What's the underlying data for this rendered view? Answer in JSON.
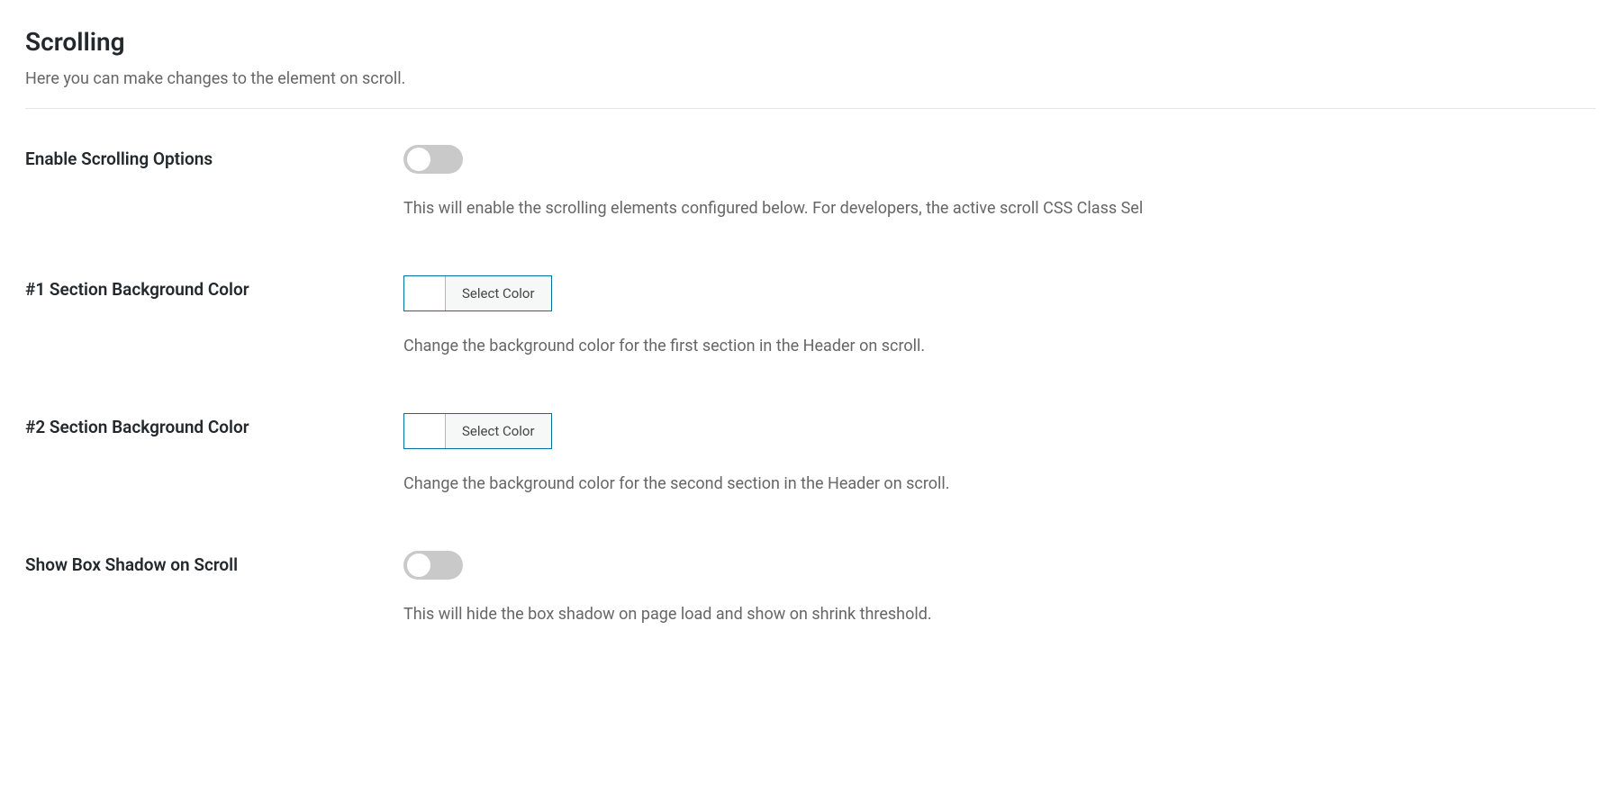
{
  "section": {
    "title": "Scrolling",
    "description": "Here you can make changes to the element on scroll."
  },
  "options": {
    "enable_scrolling": {
      "label": "Enable Scrolling Options",
      "help": "This will enable the scrolling elements configured below. For developers, the active scroll CSS Class Sel",
      "value": false
    },
    "section1_bg": {
      "label": "#1 Section Background Color",
      "button_text": "Select Color",
      "help": "Change the background color for the first section in the Header on scroll."
    },
    "section2_bg": {
      "label": "#2 Section Background Color",
      "button_text": "Select Color",
      "help": "Change the background color for the second section in the Header on scroll."
    },
    "box_shadow": {
      "label": "Show Box Shadow on Scroll",
      "help": "This will hide the box shadow on page load and show on shrink threshold.",
      "value": false
    }
  }
}
